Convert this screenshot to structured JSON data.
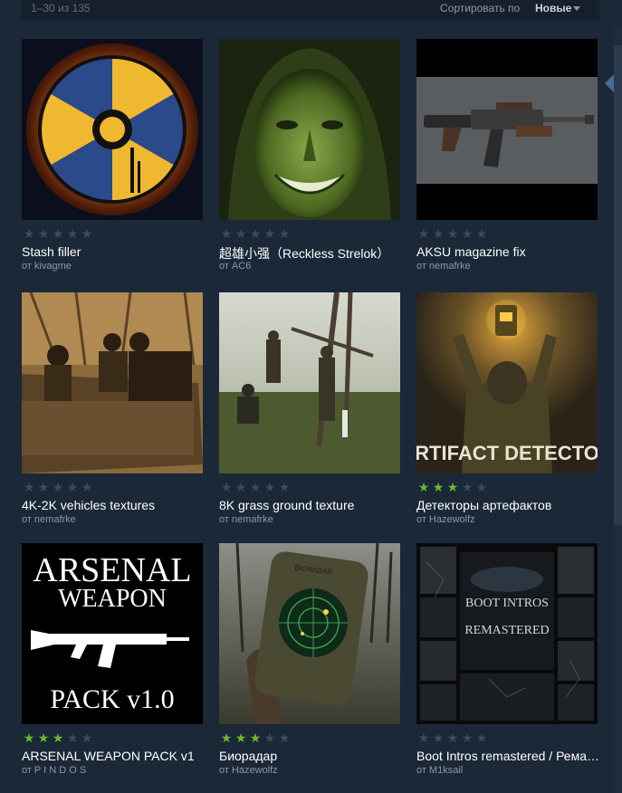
{
  "toolbar": {
    "count_text": "1–30 из 135",
    "sort_label": "Сортировать по",
    "sort_value": "Новые"
  },
  "author_prefix": "от",
  "colors": {
    "background": "#1b2838",
    "star_on": "#6eb92b",
    "star_off": "#3d4b5c",
    "title": "#ffffff",
    "author": "#8f98a0"
  },
  "items": [
    {
      "title": "Stash filler",
      "author": "kivagme",
      "rating": 0,
      "image": "radiation-symbol-artwork"
    },
    {
      "title": "超雄小强（Reckless Strelok）",
      "author": "AC6",
      "rating": 0,
      "image": "green-face-hood-artwork"
    },
    {
      "title": "AKSU magazine fix",
      "author": "nemafrke",
      "rating": 0,
      "image": "aksu-rifle-render"
    },
    {
      "title": "4K-2K vehicles textures",
      "author": "nemafrke",
      "rating": 0,
      "image": "vehicle-sepia-photo"
    },
    {
      "title": "8K grass ground texture",
      "author": "nemafrke",
      "rating": 0,
      "image": "grass-field-photo"
    },
    {
      "title": "Детекторы артефактов",
      "author": "Hazewolfz",
      "rating": 3,
      "image": "artifact-detector-artwork",
      "image_text": "ARTIFACT DETECTOR"
    },
    {
      "title": "ARSENAL WEAPON PACK v1",
      "author": "P I N D O S",
      "rating": 3,
      "image": "arsenal-weapon-pack-logo",
      "image_text": [
        "ARSENAL",
        "WEAPON",
        "PACK v1.0"
      ]
    },
    {
      "title": "Биорадар",
      "author": "Hazewolfz",
      "rating": 3,
      "image": "bioradar-device-artwork",
      "image_text": "BIORADAR"
    },
    {
      "title": "Boot Intros remastered / Ремастер загрузочных заставок",
      "author": "M1ksail",
      "rating": 0,
      "image": "boot-intros-collage",
      "image_text": [
        "BOOT INTROS",
        "REMASTERED"
      ]
    }
  ]
}
